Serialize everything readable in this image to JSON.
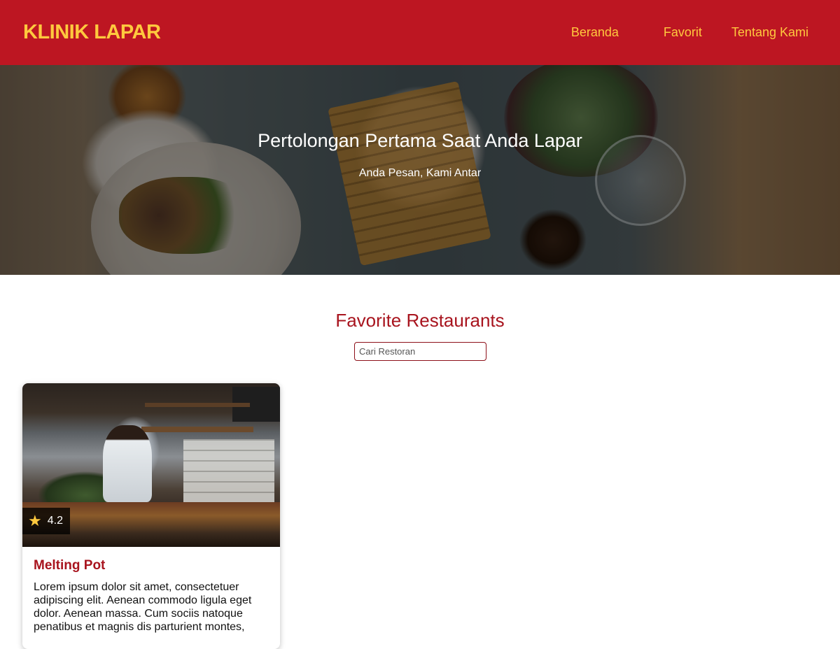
{
  "header": {
    "brand": "KLINIK LAPAR",
    "nav": {
      "home": "Beranda",
      "favorite": "Favorit",
      "about": "Tentang Kami"
    }
  },
  "hero": {
    "title": "Pertolongan Pertama Saat Anda Lapar",
    "subtitle": "Anda Pesan, Kami Antar"
  },
  "main": {
    "section_title": "Favorite Restaurants",
    "search": {
      "placeholder": "Cari Restoran",
      "value": ""
    },
    "restaurants": [
      {
        "name": "Melting Pot",
        "rating": "4.2",
        "description": "Lorem ipsum dolor sit amet, consectetuer adipiscing elit. Aenean commodo ligula eget dolor. Aenean massa. Cum sociis natoque penatibus et magnis dis parturient montes,"
      }
    ]
  },
  "icons": {
    "rating": "star-icon"
  },
  "colors": {
    "header_bg": "#bd1622",
    "brand_accent": "#ffc93e",
    "title_red": "#a8141e"
  }
}
